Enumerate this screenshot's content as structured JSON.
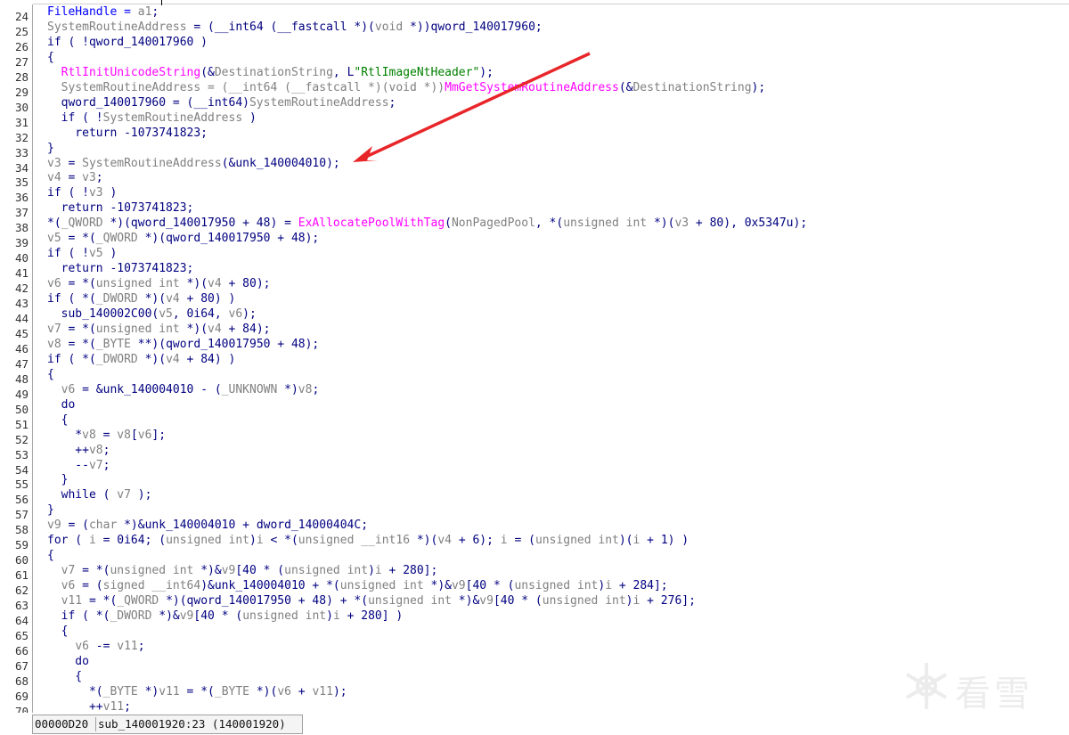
{
  "lines": [
    {
      "num": "24",
      "tokens": [
        {
          "t": "FileHandle = ",
          "c": "v"
        },
        {
          "t": "a1",
          "c": "t"
        },
        {
          "t": ";",
          "c": "k"
        }
      ]
    },
    {
      "num": "25",
      "tokens": [
        {
          "t": "SystemRoutineAddress",
          "c": "t"
        },
        {
          "t": " = (__int64 (__fastcall *)(",
          "c": "k"
        },
        {
          "t": "void",
          "c": "t"
        },
        {
          "t": " *))qword_140017960;",
          "c": "k"
        }
      ]
    },
    {
      "num": "26",
      "tokens": [
        {
          "t": "if ( !qword_140017960 )",
          "c": "k"
        }
      ]
    },
    {
      "num": "27",
      "tokens": [
        {
          "t": "{",
          "c": "k"
        }
      ]
    },
    {
      "num": "28",
      "tokens": [
        {
          "t": "  ",
          "c": "k"
        },
        {
          "t": "RtlInitUnicodeString",
          "c": "f"
        },
        {
          "t": "(&",
          "c": "k"
        },
        {
          "t": "DestinationString",
          "c": "t"
        },
        {
          "t": ", L",
          "c": "k"
        },
        {
          "t": "\"RtlImageNtHeader\"",
          "c": "s"
        },
        {
          "t": ");",
          "c": "k"
        }
      ]
    },
    {
      "num": "29",
      "tokens": [
        {
          "t": "  ",
          "c": "k"
        },
        {
          "t": "SystemRoutineAddress",
          "c": "t"
        },
        {
          "t": " = (__int64 (__fastcall *)(void *))",
          "c": "t"
        },
        {
          "t": "MmGetSystemRoutineAddress",
          "c": "f"
        },
        {
          "t": "(&",
          "c": "k"
        },
        {
          "t": "DestinationString",
          "c": "t"
        },
        {
          "t": ");",
          "c": "k"
        }
      ]
    },
    {
      "num": "30",
      "tokens": [
        {
          "t": "  qword_140017960 = (__int64)",
          "c": "k"
        },
        {
          "t": "SystemRoutineAddress",
          "c": "t"
        },
        {
          "t": ";",
          "c": "k"
        }
      ]
    },
    {
      "num": "31",
      "tokens": [
        {
          "t": "  if ( !",
          "c": "k"
        },
        {
          "t": "SystemRoutineAddress",
          "c": "t"
        },
        {
          "t": " )",
          "c": "k"
        }
      ]
    },
    {
      "num": "32",
      "tokens": [
        {
          "t": "    return -1073741823;",
          "c": "k"
        }
      ]
    },
    {
      "num": "33",
      "tokens": [
        {
          "t": "}",
          "c": "k"
        }
      ]
    },
    {
      "num": "34",
      "tokens": [
        {
          "t": "v3",
          "c": "t"
        },
        {
          "t": " = ",
          "c": "k"
        },
        {
          "t": "SystemRoutineAddress",
          "c": "t"
        },
        {
          "t": "(&unk_140004010);",
          "c": "k"
        }
      ]
    },
    {
      "num": "35",
      "tokens": [
        {
          "t": "v4",
          "c": "t"
        },
        {
          "t": " = ",
          "c": "k"
        },
        {
          "t": "v3",
          "c": "t"
        },
        {
          "t": ";",
          "c": "k"
        }
      ]
    },
    {
      "num": "36",
      "tokens": [
        {
          "t": "if ( !",
          "c": "k"
        },
        {
          "t": "v3",
          "c": "t"
        },
        {
          "t": " )",
          "c": "k"
        }
      ]
    },
    {
      "num": "37",
      "tokens": [
        {
          "t": "  return -1073741823;",
          "c": "k"
        }
      ]
    },
    {
      "num": "38",
      "tokens": [
        {
          "t": "*(",
          "c": "k"
        },
        {
          "t": "_QWORD",
          "c": "t"
        },
        {
          "t": " *)(qword_140017950 + 48) = ",
          "c": "k"
        },
        {
          "t": "ExAllocatePoolWithTag",
          "c": "f"
        },
        {
          "t": "(",
          "c": "k"
        },
        {
          "t": "NonPagedPool",
          "c": "t"
        },
        {
          "t": ", *(",
          "c": "k"
        },
        {
          "t": "unsigned int",
          "c": "t"
        },
        {
          "t": " *)(",
          "c": "k"
        },
        {
          "t": "v3",
          "c": "t"
        },
        {
          "t": " + 80), 0x5347u);",
          "c": "k"
        }
      ]
    },
    {
      "num": "39",
      "tokens": [
        {
          "t": "v5",
          "c": "t"
        },
        {
          "t": " = *(",
          "c": "k"
        },
        {
          "t": "_QWORD",
          "c": "t"
        },
        {
          "t": " *)(qword_140017950 + 48);",
          "c": "k"
        }
      ]
    },
    {
      "num": "40",
      "tokens": [
        {
          "t": "if ( !",
          "c": "k"
        },
        {
          "t": "v5",
          "c": "t"
        },
        {
          "t": " )",
          "c": "k"
        }
      ]
    },
    {
      "num": "41",
      "tokens": [
        {
          "t": "  return -1073741823;",
          "c": "k"
        }
      ]
    },
    {
      "num": "42",
      "tokens": [
        {
          "t": "v6",
          "c": "t"
        },
        {
          "t": " = *(",
          "c": "k"
        },
        {
          "t": "unsigned int",
          "c": "t"
        },
        {
          "t": " *)(",
          "c": "k"
        },
        {
          "t": "v4",
          "c": "t"
        },
        {
          "t": " + 80);",
          "c": "k"
        }
      ]
    },
    {
      "num": "43",
      "tokens": [
        {
          "t": "if ( *(",
          "c": "k"
        },
        {
          "t": "_DWORD",
          "c": "t"
        },
        {
          "t": " *)(",
          "c": "k"
        },
        {
          "t": "v4",
          "c": "t"
        },
        {
          "t": " + 80) )",
          "c": "k"
        }
      ]
    },
    {
      "num": "44",
      "tokens": [
        {
          "t": "  sub_140002C00(",
          "c": "k"
        },
        {
          "t": "v5",
          "c": "t"
        },
        {
          "t": ", 0i64, ",
          "c": "k"
        },
        {
          "t": "v6",
          "c": "t"
        },
        {
          "t": ");",
          "c": "k"
        }
      ]
    },
    {
      "num": "45",
      "tokens": [
        {
          "t": "v7",
          "c": "t"
        },
        {
          "t": " = *(",
          "c": "k"
        },
        {
          "t": "unsigned int",
          "c": "t"
        },
        {
          "t": " *)(",
          "c": "k"
        },
        {
          "t": "v4",
          "c": "t"
        },
        {
          "t": " + 84);",
          "c": "k"
        }
      ]
    },
    {
      "num": "46",
      "tokens": [
        {
          "t": "v8",
          "c": "t"
        },
        {
          "t": " = *(",
          "c": "k"
        },
        {
          "t": "_BYTE",
          "c": "t"
        },
        {
          "t": " **)(qword_140017950 + 48);",
          "c": "k"
        }
      ]
    },
    {
      "num": "47",
      "tokens": [
        {
          "t": "if ( *(",
          "c": "k"
        },
        {
          "t": "_DWORD",
          "c": "t"
        },
        {
          "t": " *)(",
          "c": "k"
        },
        {
          "t": "v4",
          "c": "t"
        },
        {
          "t": " + 84) )",
          "c": "k"
        }
      ]
    },
    {
      "num": "48",
      "tokens": [
        {
          "t": "{",
          "c": "k"
        }
      ]
    },
    {
      "num": "49",
      "tokens": [
        {
          "t": "  ",
          "c": "k"
        },
        {
          "t": "v6",
          "c": "t"
        },
        {
          "t": " = &unk_140004010 - (",
          "c": "k"
        },
        {
          "t": "_UNKNOWN",
          "c": "t"
        },
        {
          "t": " *)",
          "c": "k"
        },
        {
          "t": "v8",
          "c": "t"
        },
        {
          "t": ";",
          "c": "k"
        }
      ]
    },
    {
      "num": "50",
      "tokens": [
        {
          "t": "  do",
          "c": "k"
        }
      ]
    },
    {
      "num": "51",
      "tokens": [
        {
          "t": "  {",
          "c": "k"
        }
      ]
    },
    {
      "num": "52",
      "tokens": [
        {
          "t": "    *",
          "c": "k"
        },
        {
          "t": "v8",
          "c": "t"
        },
        {
          "t": " = ",
          "c": "k"
        },
        {
          "t": "v8",
          "c": "t"
        },
        {
          "t": "[",
          "c": "k"
        },
        {
          "t": "v6",
          "c": "t"
        },
        {
          "t": "];",
          "c": "k"
        }
      ]
    },
    {
      "num": "53",
      "tokens": [
        {
          "t": "    ++",
          "c": "k"
        },
        {
          "t": "v8",
          "c": "t"
        },
        {
          "t": ";",
          "c": "k"
        }
      ]
    },
    {
      "num": "54",
      "tokens": [
        {
          "t": "    --",
          "c": "k"
        },
        {
          "t": "v7",
          "c": "t"
        },
        {
          "t": ";",
          "c": "k"
        }
      ]
    },
    {
      "num": "55",
      "tokens": [
        {
          "t": "  }",
          "c": "k"
        }
      ]
    },
    {
      "num": "56",
      "tokens": [
        {
          "t": "  while ( ",
          "c": "k"
        },
        {
          "t": "v7",
          "c": "t"
        },
        {
          "t": " );",
          "c": "k"
        }
      ]
    },
    {
      "num": "57",
      "tokens": [
        {
          "t": "}",
          "c": "k"
        }
      ]
    },
    {
      "num": "58",
      "tokens": [
        {
          "t": "v9",
          "c": "t"
        },
        {
          "t": " = (",
          "c": "k"
        },
        {
          "t": "char",
          "c": "t"
        },
        {
          "t": " *)&unk_140004010 + dword_14000404C;",
          "c": "k"
        }
      ]
    },
    {
      "num": "59",
      "tokens": [
        {
          "t": "for ( ",
          "c": "k"
        },
        {
          "t": "i",
          "c": "t"
        },
        {
          "t": " = 0i64; (",
          "c": "k"
        },
        {
          "t": "unsigned int",
          "c": "t"
        },
        {
          "t": ")",
          "c": "k"
        },
        {
          "t": "i",
          "c": "t"
        },
        {
          "t": " < *(",
          "c": "k"
        },
        {
          "t": "unsigned __int16",
          "c": "t"
        },
        {
          "t": " *)(",
          "c": "k"
        },
        {
          "t": "v4",
          "c": "t"
        },
        {
          "t": " + 6); ",
          "c": "k"
        },
        {
          "t": "i",
          "c": "t"
        },
        {
          "t": " = (",
          "c": "k"
        },
        {
          "t": "unsigned int",
          "c": "t"
        },
        {
          "t": ")(",
          "c": "k"
        },
        {
          "t": "i",
          "c": "t"
        },
        {
          "t": " + 1) )",
          "c": "k"
        }
      ]
    },
    {
      "num": "60",
      "tokens": [
        {
          "t": "{",
          "c": "k"
        }
      ]
    },
    {
      "num": "61",
      "tokens": [
        {
          "t": "  ",
          "c": "k"
        },
        {
          "t": "v7",
          "c": "t"
        },
        {
          "t": " = *(",
          "c": "k"
        },
        {
          "t": "unsigned int",
          "c": "t"
        },
        {
          "t": " *)&",
          "c": "k"
        },
        {
          "t": "v9",
          "c": "t"
        },
        {
          "t": "[40 * (",
          "c": "k"
        },
        {
          "t": "unsigned int",
          "c": "t"
        },
        {
          "t": ")",
          "c": "k"
        },
        {
          "t": "i",
          "c": "t"
        },
        {
          "t": " + 280];",
          "c": "k"
        }
      ]
    },
    {
      "num": "62",
      "tokens": [
        {
          "t": "  ",
          "c": "k"
        },
        {
          "t": "v6",
          "c": "t"
        },
        {
          "t": " = (",
          "c": "k"
        },
        {
          "t": "signed __int64",
          "c": "t"
        },
        {
          "t": ")&unk_140004010 + *(",
          "c": "k"
        },
        {
          "t": "unsigned int",
          "c": "t"
        },
        {
          "t": " *)&",
          "c": "k"
        },
        {
          "t": "v9",
          "c": "t"
        },
        {
          "t": "[40 * (",
          "c": "k"
        },
        {
          "t": "unsigned int",
          "c": "t"
        },
        {
          "t": ")",
          "c": "k"
        },
        {
          "t": "i",
          "c": "t"
        },
        {
          "t": " + 284];",
          "c": "k"
        }
      ]
    },
    {
      "num": "63",
      "tokens": [
        {
          "t": "  ",
          "c": "k"
        },
        {
          "t": "v11",
          "c": "t"
        },
        {
          "t": " = *(",
          "c": "k"
        },
        {
          "t": "_QWORD",
          "c": "t"
        },
        {
          "t": " *)(qword_140017950 + 48) + *(",
          "c": "k"
        },
        {
          "t": "unsigned int",
          "c": "t"
        },
        {
          "t": " *)&",
          "c": "k"
        },
        {
          "t": "v9",
          "c": "t"
        },
        {
          "t": "[40 * (",
          "c": "k"
        },
        {
          "t": "unsigned int",
          "c": "t"
        },
        {
          "t": ")",
          "c": "k"
        },
        {
          "t": "i",
          "c": "t"
        },
        {
          "t": " + 276];",
          "c": "k"
        }
      ]
    },
    {
      "num": "64",
      "tokens": [
        {
          "t": "  if ( *(",
          "c": "k"
        },
        {
          "t": "_DWORD",
          "c": "t"
        },
        {
          "t": " *)&",
          "c": "k"
        },
        {
          "t": "v9",
          "c": "t"
        },
        {
          "t": "[40 * (",
          "c": "k"
        },
        {
          "t": "unsigned int",
          "c": "t"
        },
        {
          "t": ")",
          "c": "k"
        },
        {
          "t": "i",
          "c": "t"
        },
        {
          "t": " + 280] )",
          "c": "k"
        }
      ]
    },
    {
      "num": "65",
      "tokens": [
        {
          "t": "  {",
          "c": "k"
        }
      ]
    },
    {
      "num": "66",
      "tokens": [
        {
          "t": "    ",
          "c": "k"
        },
        {
          "t": "v6",
          "c": "t"
        },
        {
          "t": " -= ",
          "c": "k"
        },
        {
          "t": "v11",
          "c": "t"
        },
        {
          "t": ";",
          "c": "k"
        }
      ]
    },
    {
      "num": "67",
      "tokens": [
        {
          "t": "    do",
          "c": "k"
        }
      ]
    },
    {
      "num": "68",
      "tokens": [
        {
          "t": "    {",
          "c": "k"
        }
      ]
    },
    {
      "num": "69",
      "tokens": [
        {
          "t": "      *(",
          "c": "k"
        },
        {
          "t": "_BYTE",
          "c": "t"
        },
        {
          "t": " *)",
          "c": "k"
        },
        {
          "t": "v11",
          "c": "t"
        },
        {
          "t": " = *(",
          "c": "k"
        },
        {
          "t": "_BYTE",
          "c": "t"
        },
        {
          "t": " *)(",
          "c": "k"
        },
        {
          "t": "v6",
          "c": "t"
        },
        {
          "t": " + ",
          "c": "k"
        },
        {
          "t": "v11",
          "c": "t"
        },
        {
          "t": ");",
          "c": "k"
        }
      ]
    },
    {
      "num": "70",
      "tokens": [
        {
          "t": "      ++",
          "c": "k"
        },
        {
          "t": "v11",
          "c": "t"
        },
        {
          "t": ";",
          "c": "k"
        }
      ]
    }
  ],
  "status_bar": {
    "offset": "00000D20",
    "location": "sub_140001920:23 (140001920)"
  },
  "watermark": {
    "text": "看雪",
    "icon": "snowflake-icon"
  },
  "annotation": {
    "type": "red-arrow",
    "color": "#e8262a",
    "points_to_line": "34"
  },
  "colors": {
    "keyword": "#000080",
    "variable": "#808080",
    "function": "#ff00ff",
    "string": "#008000",
    "background": "#ffffff"
  }
}
